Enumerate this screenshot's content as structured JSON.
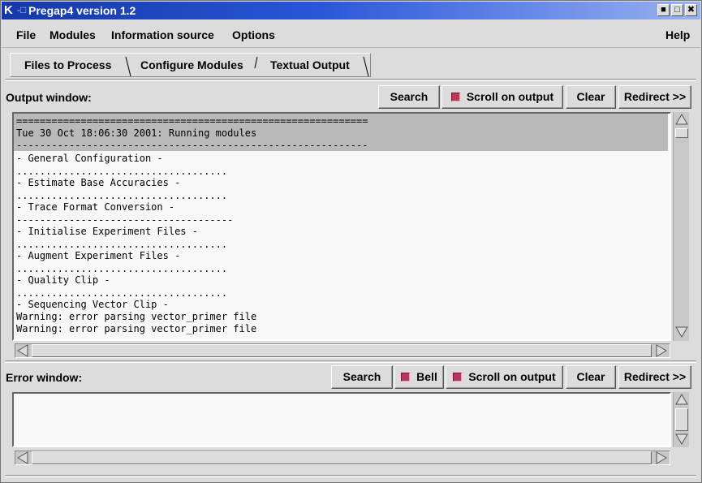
{
  "window": {
    "title": "Pregap4 version 1.2",
    "logo": "K",
    "pin_glyph": "-□"
  },
  "colors": {
    "titlebar": "#2a55d6",
    "indicator": "#b8385a",
    "highlight": "#b9b9b9",
    "text_bg": "#f8f8f8"
  },
  "menubar": {
    "items": [
      "File",
      "Modules",
      "Information source",
      "Options"
    ],
    "help": "Help"
  },
  "tabs": [
    {
      "label": "Files to Process",
      "selected": false
    },
    {
      "label": "Configure Modules",
      "selected": false
    },
    {
      "label": "Textual Output",
      "selected": true
    }
  ],
  "output_panel": {
    "label": "Output window:",
    "search": "Search",
    "scroll_on_output": "Scroll on output",
    "clear": "Clear",
    "redirect": "Redirect >>",
    "lines": [
      "============================================================",
      "Tue 30 Oct 18:06:30 2001: Running modules",
      "------------------------------------------------------------",
      "- General Configuration -",
      "....................................",
      "- Estimate Base Accuracies -",
      "....................................",
      "- Trace Format Conversion -",
      "-------------------------------------",
      "- Initialise Experiment Files -",
      "....................................",
      "- Augment Experiment Files -",
      "....................................",
      "- Quality Clip -",
      "....................................",
      "- Sequencing Vector Clip -",
      "Warning: error parsing vector_primer file",
      "Warning: error parsing vector_primer file"
    ]
  },
  "error_panel": {
    "label": "Error window:",
    "search": "Search",
    "bell": "Bell",
    "scroll_on_output": "Scroll on output",
    "clear": "Clear",
    "redirect": "Redirect >>"
  }
}
